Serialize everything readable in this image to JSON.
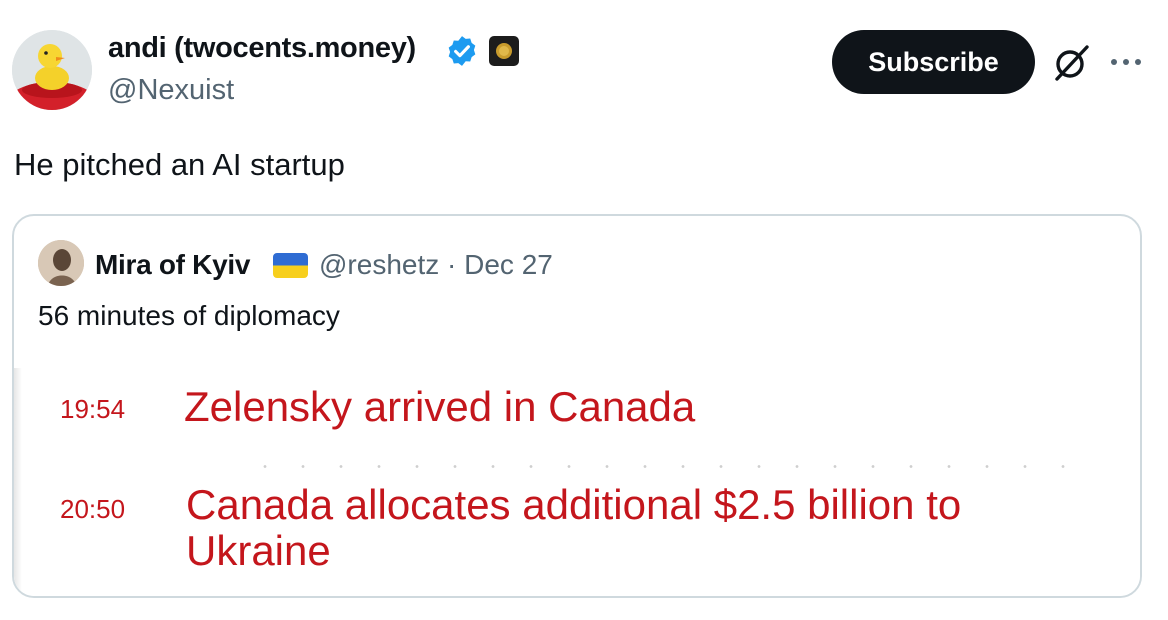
{
  "author": {
    "display_name": "andi (twocents.money)",
    "handle": "@Nexuist",
    "verified_icon": "verified-badge-icon",
    "affiliation_icon": "affiliate-badge-icon"
  },
  "actions": {
    "subscribe_label": "Subscribe",
    "grok_icon": "grok-icon",
    "more_icon": "more-options-icon"
  },
  "tweet": {
    "text": "He pitched an AI startup"
  },
  "quote": {
    "author_name": "Mira of Kyiv",
    "flag": "ukraine-flag",
    "meta": "@reshetz · Dec 27",
    "text": "56 minutes of diplomacy",
    "image": {
      "entries": [
        {
          "time": "19:54",
          "headline": "Zelensky arrived in Canada"
        },
        {
          "time": "20:50",
          "headline": "Canada allocates additional $2.5 billion to Ukraine"
        }
      ]
    }
  },
  "colors": {
    "brand_blue": "#1d9bf0",
    "text_primary": "#0f1419",
    "text_secondary": "#536471",
    "headline_red": "#c4161c",
    "border": "#cfd9de"
  }
}
